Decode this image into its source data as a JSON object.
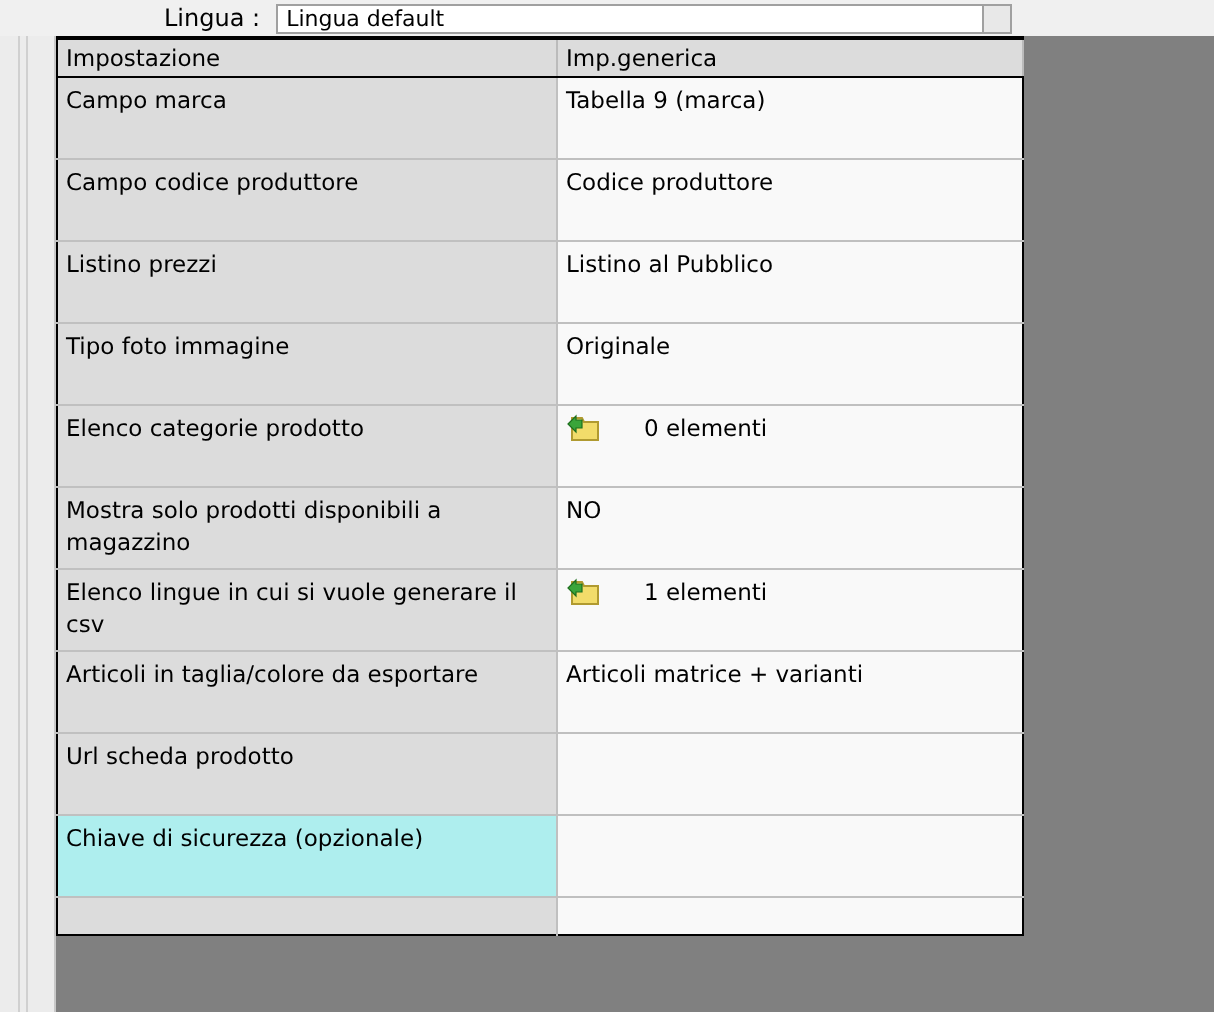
{
  "language_selector": {
    "label": "Lingua :",
    "value": "Lingua default"
  },
  "table": {
    "columns": [
      "Impostazione",
      "Imp.generica"
    ],
    "rows": [
      {
        "setting": "Campo marca",
        "kind": "text",
        "value": "Tabella 9 (marca)",
        "selected": false
      },
      {
        "setting": "Campo codice produttore",
        "kind": "text",
        "value": "Codice produttore",
        "selected": false
      },
      {
        "setting": "Listino prezzi",
        "kind": "text",
        "value": "Listino al Pubblico",
        "selected": false
      },
      {
        "setting": "Tipo foto immagine",
        "kind": "text",
        "value": "Originale",
        "selected": false
      },
      {
        "setting": "Elenco categorie prodotto",
        "kind": "list",
        "value": "0 elementi",
        "selected": false
      },
      {
        "setting": "Mostra solo prodotti disponibili a magazzino",
        "kind": "text",
        "value": "NO",
        "selected": false
      },
      {
        "setting": "Elenco lingue in cui si vuole generare il csv",
        "kind": "list",
        "value": "1 elementi",
        "selected": false
      },
      {
        "setting": "Articoli in taglia/colore da esportare",
        "kind": "text",
        "value": "Articoli matrice + varianti",
        "selected": false
      },
      {
        "setting": "Url scheda prodotto",
        "kind": "text",
        "value": "",
        "selected": false
      },
      {
        "setting": "Chiave di sicurezza (opzionale)",
        "kind": "text",
        "value": "",
        "selected": true
      }
    ]
  }
}
